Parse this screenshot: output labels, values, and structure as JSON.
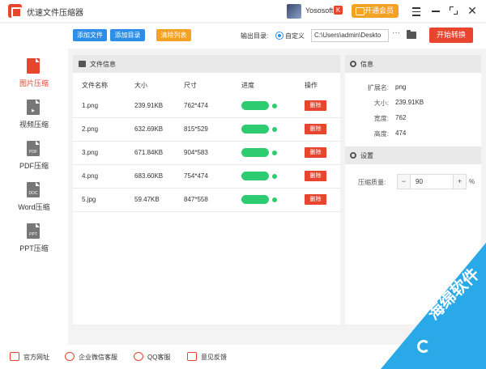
{
  "app": {
    "title": "优速文件压缩器"
  },
  "user": {
    "name": "Yososoft",
    "badge": "K",
    "vip_label": "开通会员"
  },
  "window": {
    "close_glyph": "✕"
  },
  "toolbar": {
    "add_file": "添加文件",
    "add_dir": "添加目录",
    "clear_list": "清除列表",
    "output_label": "输出目录:",
    "custom_label": "自定义",
    "path": "C:\\Users\\admin\\Deskto",
    "more": "···",
    "start": "开始转换"
  },
  "sidebar": {
    "items": [
      {
        "label": "图片压缩",
        "glyph": "",
        "icon": "image-file-icon",
        "active": true
      },
      {
        "label": "视频压缩",
        "glyph": "▶",
        "icon": "video-file-icon",
        "active": false
      },
      {
        "label": "PDF压缩",
        "glyph": "PDF",
        "icon": "pdf-file-icon",
        "active": false
      },
      {
        "label": "Word压缩",
        "glyph": "DOC",
        "icon": "word-file-icon",
        "active": false
      },
      {
        "label": "PPT压缩",
        "glyph": "PPT",
        "icon": "ppt-file-icon",
        "active": false
      }
    ]
  },
  "files_panel": {
    "title": "文件信息",
    "columns": [
      "文件名称",
      "大小",
      "尺寸",
      "进度",
      "操作"
    ],
    "delete_label": "删除",
    "rows": [
      {
        "name": "1.png",
        "size": "239.91KB",
        "dims": "762*474",
        "progress": 1.0
      },
      {
        "name": "2.png",
        "size": "632.69KB",
        "dims": "815*529",
        "progress": 1.0
      },
      {
        "name": "3.png",
        "size": "671.84KB",
        "dims": "904*583",
        "progress": 1.0
      },
      {
        "name": "4.png",
        "size": "683.60KB",
        "dims": "754*474",
        "progress": 1.0
      },
      {
        "name": "5.jpg",
        "size": "59.47KB",
        "dims": "847*558",
        "progress": 1.0
      }
    ]
  },
  "info_panel": {
    "title": "信息",
    "fields": [
      {
        "key": "扩展名:",
        "value": "png"
      },
      {
        "key": "大小:",
        "value": "239.91KB"
      },
      {
        "key": "宽度:",
        "value": "762"
      },
      {
        "key": "高度:",
        "value": "474"
      }
    ],
    "settings_title": "设置",
    "quality_label": "压缩质量:",
    "quality_value": "90",
    "minus": "−",
    "plus": "+",
    "percent": "%"
  },
  "footer": {
    "items": [
      {
        "label": "官方网址",
        "icon": "globe-icon"
      },
      {
        "label": "企业微信客服",
        "icon": "wechat-icon"
      },
      {
        "label": "QQ客服",
        "icon": "qq-icon"
      },
      {
        "label": "意见反馈",
        "icon": "feedback-icon"
      }
    ]
  },
  "watermark": {
    "text": "海绵软件"
  },
  "colors": {
    "accent": "#e8452f",
    "primary": "#2b8ee8",
    "warning": "#f4a223",
    "success": "#2ecc71",
    "watermark": "#29a9e8"
  }
}
